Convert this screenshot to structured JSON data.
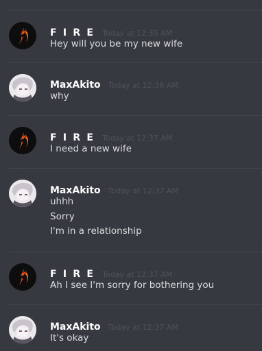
{
  "colors": {
    "background": "#36393f",
    "divider": "#40444b",
    "author": "#ffffff",
    "timestamp": "#4f5359",
    "message_text": "#dcddde",
    "fire_avatar_bg": "#0d0d0d",
    "fire_flame": "#e8501e"
  },
  "messages": [
    {
      "author": "F I R E",
      "avatar": "fire-flame-avatar",
      "timestamp": "Today at 12:35 AM",
      "lines": [
        "Hey will you be my new wife"
      ]
    },
    {
      "author": "MaxAkito",
      "avatar": "anime-character-avatar",
      "timestamp": "Today at 12:36 AM",
      "lines": [
        "why"
      ]
    },
    {
      "author": "F I R E",
      "avatar": "fire-flame-avatar",
      "timestamp": "Today at 12:37 AM",
      "lines": [
        "I need a new wife"
      ]
    },
    {
      "author": "MaxAkito",
      "avatar": "anime-character-avatar",
      "timestamp": "Today at 12:37 AM",
      "lines": [
        "uhhh",
        "Sorry",
        "I'm in a relationship"
      ]
    },
    {
      "author": "F I R E",
      "avatar": "fire-flame-avatar",
      "timestamp": "Today at 12:37 AM",
      "lines": [
        "Ah I see I'm sorry for bothering you"
      ]
    },
    {
      "author": "MaxAkito",
      "avatar": "anime-character-avatar",
      "timestamp": "Today at 12:37 AM",
      "lines": [
        "It's okay"
      ]
    }
  ]
}
